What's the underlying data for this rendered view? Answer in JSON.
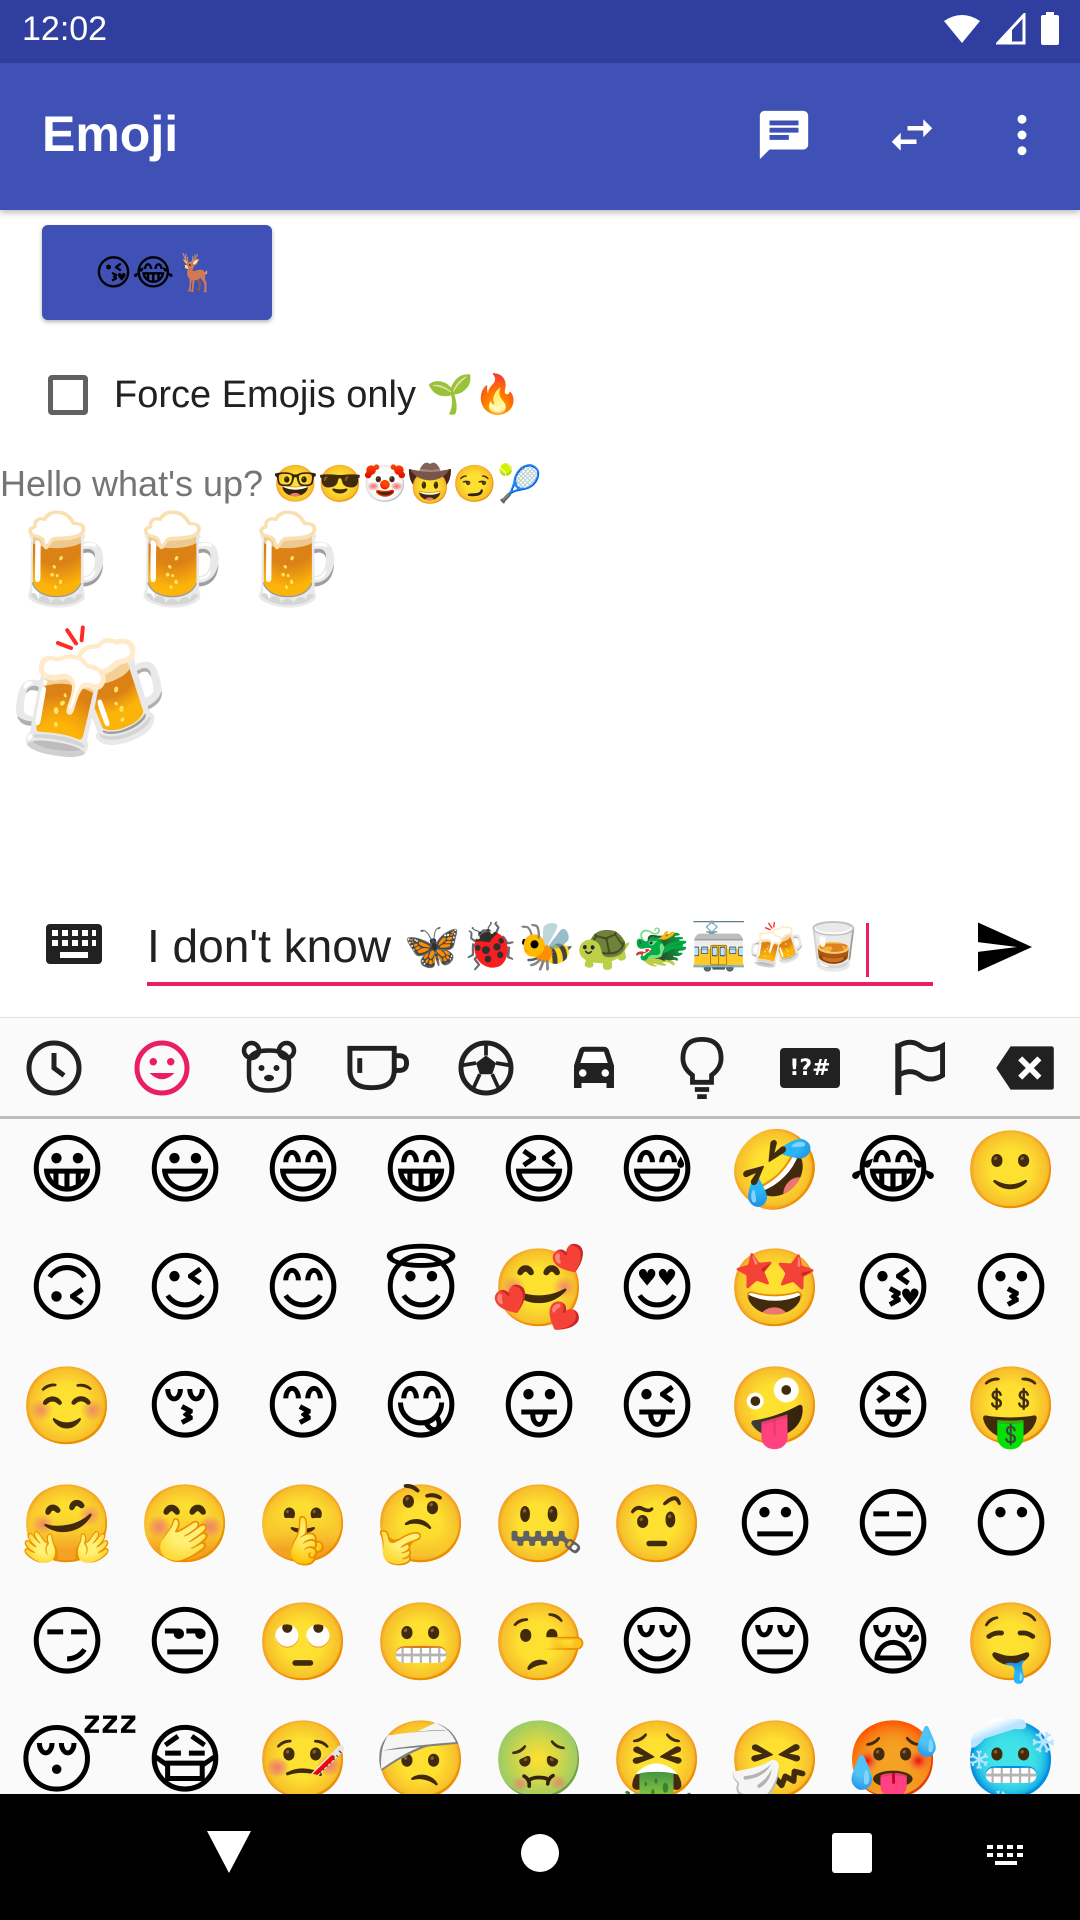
{
  "status_bar": {
    "time": "12:02"
  },
  "app_bar": {
    "title": "Emoji"
  },
  "emoji_button": {
    "label": "😘😂🦌"
  },
  "force_emojis": {
    "label": "Force Emojis only 🌱🔥",
    "checked": false
  },
  "hello_text": "Hello what's up? 🤓😎🤡🤠😏🎾",
  "beers_text": "🍺🍺🍺",
  "clink_text": "🍻",
  "message_input": {
    "value": "I don't know 🦋🐞🐝🐢🐲🚋🍻🥃"
  },
  "emoji_tabs": [
    {
      "name": "recent-icon"
    },
    {
      "name": "smileys-icon",
      "active": true
    },
    {
      "name": "animals-icon"
    },
    {
      "name": "food-icon"
    },
    {
      "name": "activity-icon"
    },
    {
      "name": "travel-icon"
    },
    {
      "name": "objects-icon"
    },
    {
      "name": "symbols-icon",
      "label": "!?#"
    },
    {
      "name": "flags-icon"
    },
    {
      "name": "backspace-icon"
    }
  ],
  "emoji_grid": [
    [
      "😀",
      "😃",
      "😄",
      "😁",
      "😆",
      "😅",
      "🤣",
      "😂",
      "🙂"
    ],
    [
      "🙃",
      "😉",
      "😊",
      "😇",
      "🥰",
      "😍",
      "🤩",
      "😘",
      "😗"
    ],
    [
      "☺️",
      "😚",
      "😙",
      "😋",
      "😛",
      "😜",
      "🤪",
      "😝",
      "🤑"
    ],
    [
      "🤗",
      "🤭",
      "🤫",
      "🤔",
      "🤐",
      "🤨",
      "😐",
      "😑",
      "😶"
    ],
    [
      "😏",
      "😒",
      "🙄",
      "😬",
      "🤥",
      "😌",
      "😔",
      "😪",
      "🤤"
    ],
    [
      "😴",
      "😷",
      "🤒",
      "🤕",
      "🤢",
      "🤮",
      "🤧",
      "🥵",
      "🥶"
    ]
  ],
  "colors": {
    "primary": "#3f51b5",
    "primary_dark": "#303f9f",
    "accent": "#e91e63"
  }
}
